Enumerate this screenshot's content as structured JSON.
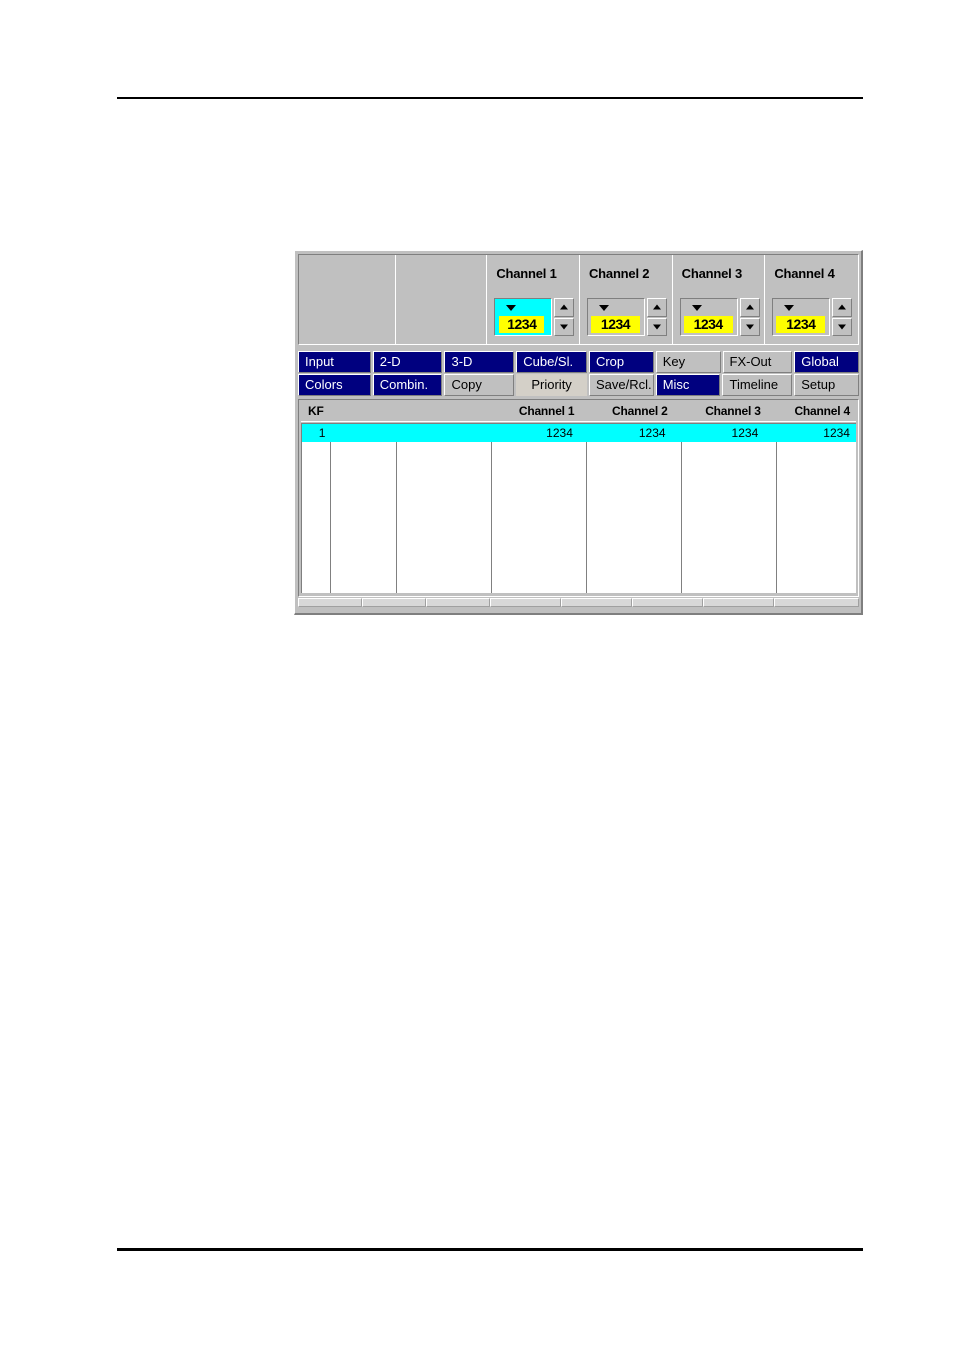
{
  "window": {
    "channel_strip": {
      "blank_cells": [
        "",
        ""
      ],
      "channels": [
        {
          "title": "Channel 1",
          "value": "1234",
          "selected": true
        },
        {
          "title": "Channel 2",
          "value": "1234",
          "selected": false
        },
        {
          "title": "Channel 3",
          "value": "1234",
          "selected": false
        },
        {
          "title": "Channel 4",
          "value": "1234",
          "selected": false
        }
      ]
    },
    "tabs": {
      "row1": [
        {
          "label": "Input",
          "state": "selected"
        },
        {
          "label": "2-D",
          "state": "selected"
        },
        {
          "label": "3-D",
          "state": "selected"
        },
        {
          "label": "Cube/Sl.",
          "state": "selected"
        },
        {
          "label": "Crop",
          "state": "selected"
        },
        {
          "label": "Key",
          "state": "normal"
        },
        {
          "label": "FX-Out",
          "state": "normal"
        },
        {
          "label": "Global",
          "state": "selected"
        }
      ],
      "row2": [
        {
          "label": "Colors",
          "state": "selected"
        },
        {
          "label": "Combin.",
          "state": "selected"
        },
        {
          "label": "Copy",
          "state": "normal"
        },
        {
          "label": "Priority",
          "state": "active"
        },
        {
          "label": "Save/Rcl.",
          "state": "normal"
        },
        {
          "label": "Misc",
          "state": "selected"
        },
        {
          "label": "Timeline",
          "state": "normal"
        },
        {
          "label": "Setup",
          "state": "normal"
        }
      ]
    },
    "keyframe_table": {
      "headers": {
        "kf": "KF",
        "col_a": "",
        "col_b": "",
        "channel_1": "Channel 1",
        "channel_2": "Channel 2",
        "channel_3": "Channel 3",
        "channel_4": "Channel 4"
      },
      "rows": [
        {
          "kf": "1",
          "col_a": "",
          "col_b": "",
          "channel_1": "1234",
          "channel_2": "1234",
          "channel_3": "1234",
          "channel_4": "1234",
          "selected": true
        }
      ]
    }
  },
  "colors": {
    "face": "#c0c0c0",
    "tab_selected_bg": "#00007f",
    "tab_selected_fg": "#ffffff",
    "tab_active_bg": "#d4d0c8",
    "row_selected_bg": "#00ffff",
    "spinner_value_bg": "#ffff00",
    "spinner_active_bg": "#00ffff"
  }
}
